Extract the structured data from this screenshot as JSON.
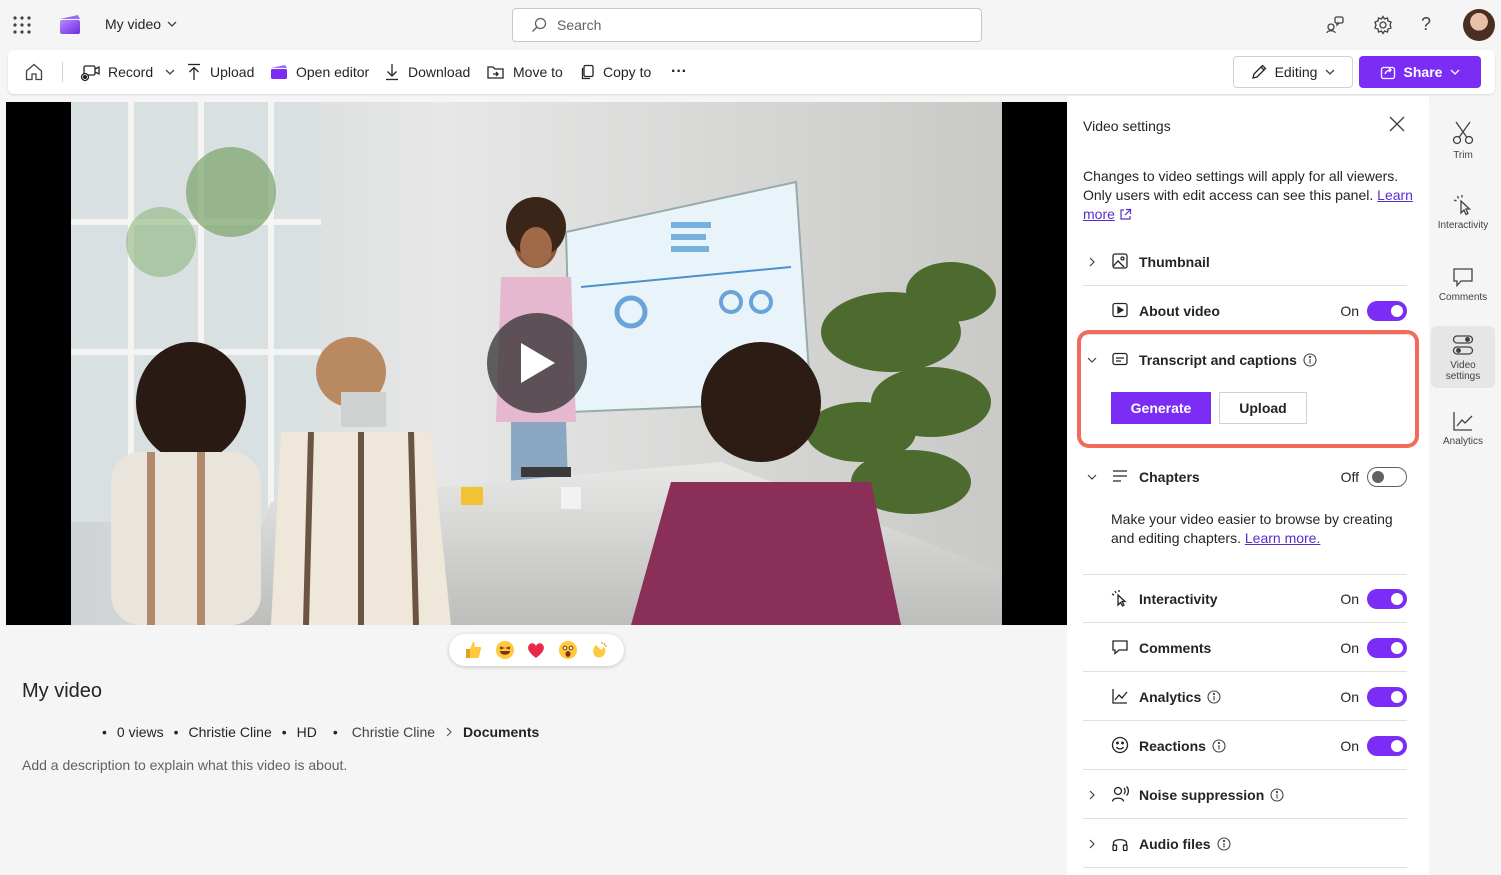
{
  "header": {
    "app_title": "My video",
    "search_placeholder": "Search"
  },
  "toolbar": {
    "record": "Record",
    "upload": "Upload",
    "open_editor": "Open editor",
    "download": "Download",
    "move_to": "Move to",
    "copy_to": "Copy to",
    "more": "···",
    "editing": "Editing",
    "share": "Share"
  },
  "video": {
    "title": "My video",
    "meta": {
      "views": "0 views",
      "owner": "Christie Cline",
      "quality": "HD",
      "location_root": "Christie Cline",
      "location_folder": "Documents"
    },
    "description": "Add a description to explain what this video is about."
  },
  "panel": {
    "title": "Video settings",
    "intro": "Changes to video settings will apply for all viewers. Only users with edit access can see this panel.",
    "learn_more": "Learn more",
    "rows": {
      "thumbnail": {
        "label": "Thumbnail"
      },
      "about": {
        "label": "About video",
        "state": "On"
      },
      "transcript": {
        "label": "Transcript and captions",
        "generate": "Generate",
        "upload": "Upload"
      },
      "chapters": {
        "label": "Chapters",
        "state": "Off",
        "desc": "Make your video easier to browse by creating and editing chapters.",
        "learn_more": "Learn more."
      },
      "interactivity": {
        "label": "Interactivity",
        "state": "On"
      },
      "comments": {
        "label": "Comments",
        "state": "On"
      },
      "analytics": {
        "label": "Analytics",
        "state": "On"
      },
      "reactions": {
        "label": "Reactions",
        "state": "On"
      },
      "noise": {
        "label": "Noise suppression"
      },
      "audio": {
        "label": "Audio files"
      }
    }
  },
  "rail": {
    "trim": "Trim",
    "interactivity": "Interactivity",
    "comments": "Comments",
    "video_settings": "Video settings",
    "analytics": "Analytics"
  },
  "colors": {
    "accent": "#7b2cf5",
    "highlight": "#f26b5b"
  }
}
